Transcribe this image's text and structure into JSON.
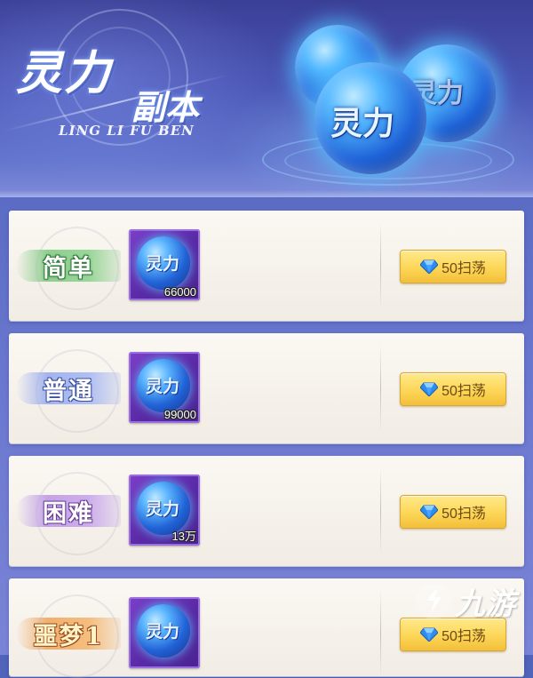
{
  "header": {
    "title_part1": "灵力",
    "title_part2": "副本",
    "title_en": "LING LI FU BEN",
    "orb_label": "灵力"
  },
  "rows": [
    {
      "difficulty": "简单",
      "item_label": "灵力",
      "item_qty": "66000",
      "sweep_label": "50扫荡",
      "badge_color": "#8fcf8f"
    },
    {
      "difficulty": "普通",
      "item_label": "灵力",
      "item_qty": "99000",
      "sweep_label": "50扫荡",
      "badge_color": "#a3b4ee"
    },
    {
      "difficulty": "困难",
      "item_label": "灵力",
      "item_qty": "13万",
      "sweep_label": "50扫荡",
      "badge_color": "#c4a3e6"
    },
    {
      "difficulty": "噩梦1",
      "item_label": "灵力",
      "item_qty": "",
      "sweep_label": "50扫荡",
      "badge_color": "#f0b070"
    }
  ],
  "icons": {
    "sweep_cost": "blue-diamond-icon",
    "item": "spirit-orb-icon"
  },
  "colors": {
    "button": "#fdd657",
    "item_frame": "#7b3fc8",
    "background": "#5b6cc4"
  },
  "watermark": {
    "text": "九游"
  }
}
